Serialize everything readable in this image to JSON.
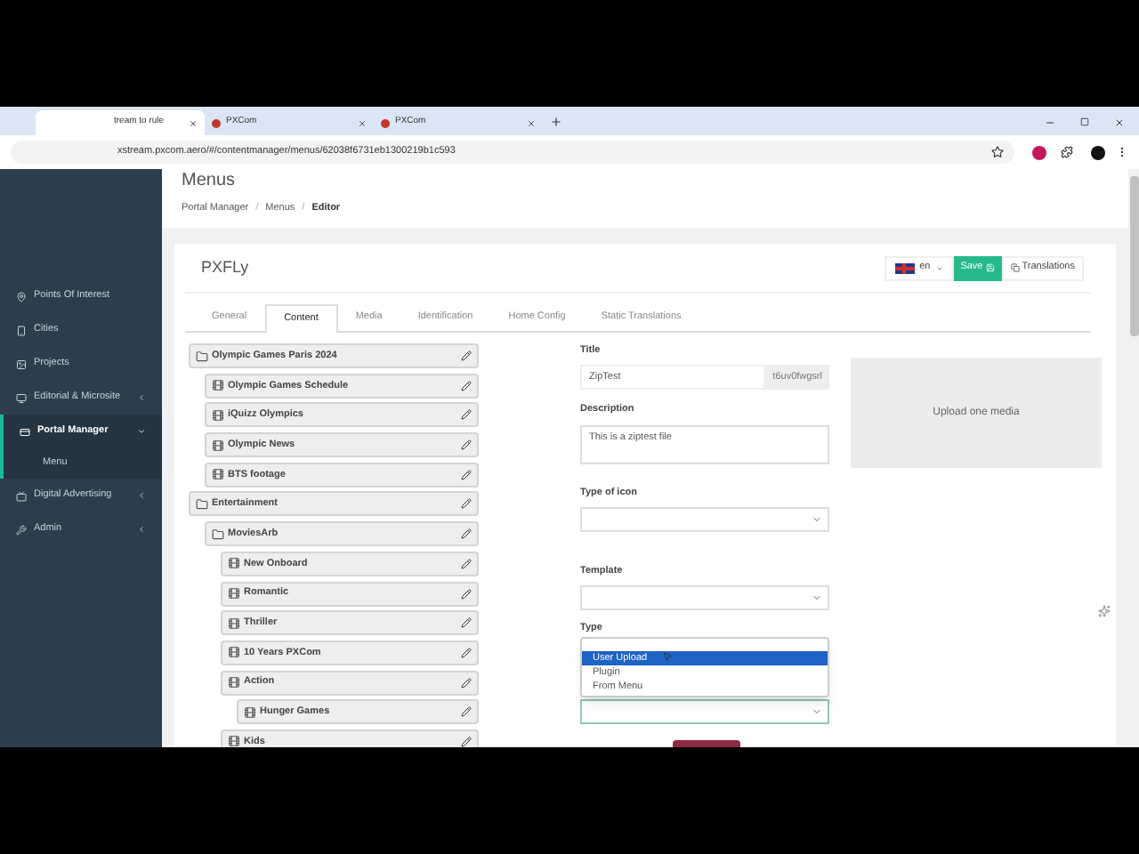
{
  "browser": {
    "tabs": [
      {
        "title": "tream to rule",
        "selected": true
      },
      {
        "title": "PXCom",
        "selected": false
      },
      {
        "title": "PXCom",
        "selected": false
      }
    ],
    "address": "xstream.pxcom.aero/#/contentmanager/menus/62038f6731eb1300219b1c593"
  },
  "sidebar": {
    "items": [
      {
        "label": "Points Of Interest",
        "selected": false
      },
      {
        "label": "Cities",
        "selected": false
      },
      {
        "label": "Projects",
        "selected": false
      },
      {
        "label": "Editorial & Microsite",
        "selected": false,
        "expanded": false
      },
      {
        "label": "Portal Manager",
        "selected": true,
        "expanded": true,
        "children": [
          {
            "label": "Menu"
          }
        ]
      },
      {
        "label": "Digital Advertising",
        "selected": false,
        "expanded": false
      },
      {
        "label": "Admin",
        "selected": false,
        "expanded": false
      }
    ]
  },
  "page": {
    "title": "Menus",
    "breadcrumb": [
      "Portal Manager",
      "Menus",
      "Editor"
    ],
    "breadcrumb_separator": "/"
  },
  "card": {
    "title": "PXFLy",
    "language": "en",
    "save": "Save",
    "translations": "Translations",
    "tabs": [
      {
        "label": "General",
        "selected": false
      },
      {
        "label": "Content",
        "selected": true
      },
      {
        "label": "Media",
        "selected": false
      },
      {
        "label": "Identification",
        "selected": false
      },
      {
        "label": "Home Config",
        "selected": false
      },
      {
        "label": "Static Translations",
        "selected": false
      }
    ]
  },
  "tree": [
    {
      "label": "Olympic Games Paris 2024",
      "kind": "folder",
      "children": [
        {
          "label": "Olympic Games Schedule",
          "kind": "item"
        },
        {
          "label": "iQuizz Olympics",
          "kind": "item"
        },
        {
          "label": "Olympic News",
          "kind": "item"
        },
        {
          "label": "BTS footage",
          "kind": "item"
        }
      ]
    },
    {
      "label": "Entertainment",
      "kind": "folder",
      "children": [
        {
          "label": "MoviesArb",
          "kind": "folder",
          "children": [
            {
              "label": "New Onboard",
              "kind": "item"
            },
            {
              "label": "Romantic",
              "kind": "item"
            },
            {
              "label": "Thriller",
              "kind": "item"
            },
            {
              "label": "10 Years PXCom",
              "kind": "item"
            },
            {
              "label": "Action",
              "kind": "item",
              "children": [
                {
                  "label": "Hunger Games",
                  "kind": "item"
                }
              ]
            },
            {
              "label": "Kids",
              "kind": "item"
            }
          ]
        }
      ]
    }
  ],
  "form": {
    "title_label": "Title",
    "title_value": "ZipTest",
    "title_suffix": "t6uv0fwgsrl",
    "description_label": "Description",
    "description_value": "This is a ziptest file",
    "icon_type_label": "Type of icon",
    "template_label": "Template",
    "type_label": "Type",
    "type_options": [
      {
        "label": "User Upload",
        "selected": true
      },
      {
        "label": "Plugin",
        "selected": false
      },
      {
        "label": "From Menu",
        "selected": false
      }
    ],
    "upload": "Upload one media"
  }
}
